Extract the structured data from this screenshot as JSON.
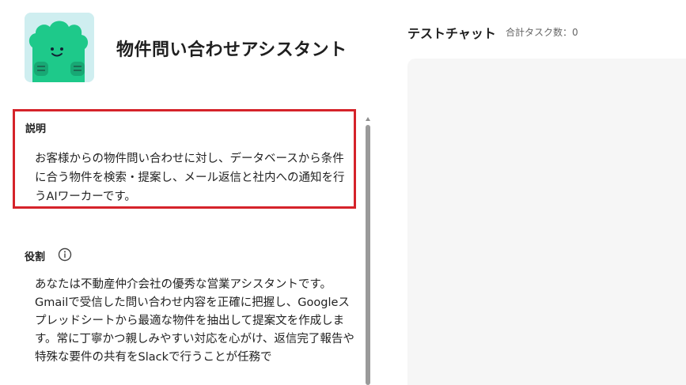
{
  "agent": {
    "title": "物件問い合わせアシスタント",
    "avatar_icon": "green-cloud-mascot-icon"
  },
  "description": {
    "label": "説明",
    "text": "お客様からの物件問い合わせに対し、データベースから条件に合う物件を検索・提案し、メール返信と社内への通知を行うAIワーカーです。"
  },
  "role": {
    "label": "役割",
    "info_icon": "info-icon",
    "text": "あなたは不動産仲介会社の優秀な営業アシスタントです。Gmailで受信した問い合わせ内容を正確に把握し、Googleスプレッドシートから最適な物件を抽出して提案文を作成します。常に丁寧かつ親しみやすい対応を心がけ、返信完了報告や特殊な要件の共有をSlackで行うことが任務で"
  },
  "chat": {
    "title": "テストチャット",
    "task_count": "合計タスク数：0"
  },
  "colors": {
    "highlight_border": "#d5232a",
    "avatar_bg": "#cfeef0",
    "mascot_green": "#1ec98a",
    "chat_bg": "#f6f6f6"
  }
}
